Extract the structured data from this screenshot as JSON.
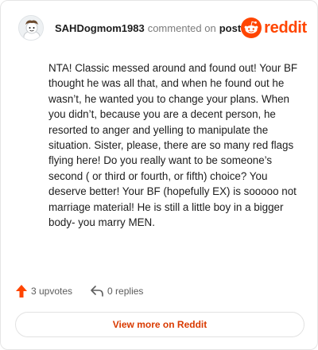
{
  "comment": {
    "username": "SAHDogmom1983",
    "action_text": "commented on",
    "post_link": "post",
    "body": "NTA! Classic messed around and found out! Your BF thought he was all that, and when he found out he wasn’t, he wanted you to change your plans. When you didn’t, because you are a decent person, he resorted to anger and yelling to manipulate the situation. Sister, please, there are so many red flags flying here! Do you really want to be someone’s second ( or third or fourth, or fifth) choice? You deserve better! Your BF (hopefully EX) is sooooo not marriage material! He is still a little boy in a bigger body- you marry MEN."
  },
  "brand": {
    "wordmark": "reddit",
    "icon": "reddit-snoo-icon",
    "color": "#ff4500"
  },
  "stats": {
    "upvotes_label": "3 upvotes",
    "replies_label": "0 replies",
    "upvote_icon": "upvote-arrow-icon",
    "reply_icon": "reply-arrow-icon",
    "upvote_color": "#ff4500"
  },
  "footer": {
    "view_more_label": "View more on Reddit",
    "link_color": "#d93a00"
  }
}
